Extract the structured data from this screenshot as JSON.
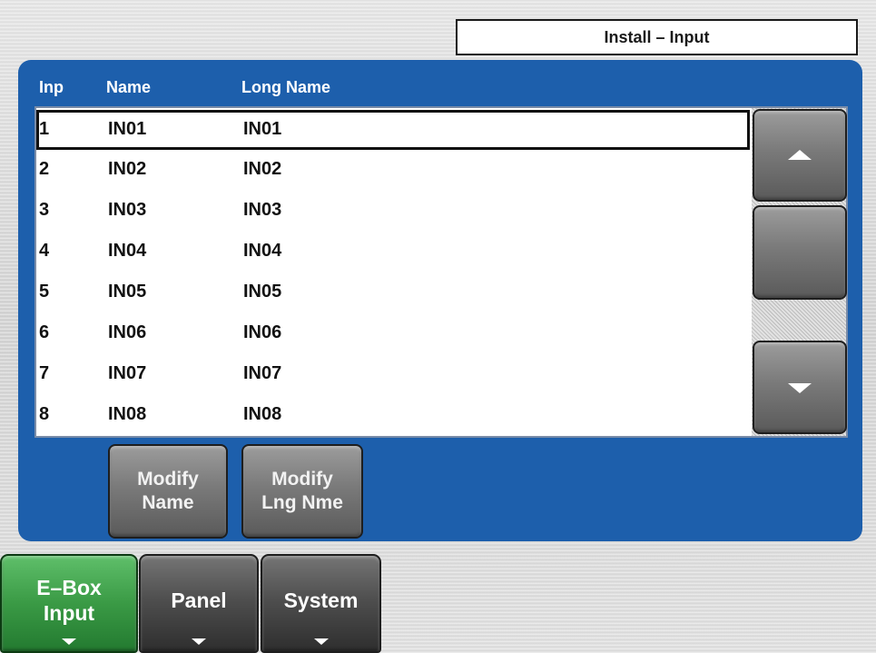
{
  "header": {
    "title": "Install – Input"
  },
  "table": {
    "columns": [
      "Inp",
      "Name",
      "Long Name"
    ],
    "rows": [
      {
        "inp": "1",
        "name": "IN01",
        "long_name": "IN01"
      },
      {
        "inp": "2",
        "name": "IN02",
        "long_name": "IN02"
      },
      {
        "inp": "3",
        "name": "IN03",
        "long_name": "IN03"
      },
      {
        "inp": "4",
        "name": "IN04",
        "long_name": "IN04"
      },
      {
        "inp": "5",
        "name": "IN05",
        "long_name": "IN05"
      },
      {
        "inp": "6",
        "name": "IN06",
        "long_name": "IN06"
      },
      {
        "inp": "7",
        "name": "IN07",
        "long_name": "IN07"
      },
      {
        "inp": "8",
        "name": "IN08",
        "long_name": "IN08"
      }
    ],
    "selected_index": 0
  },
  "scrollbar": {
    "up_icon": "arrow-up-icon",
    "down_icon": "arrow-down-icon"
  },
  "actions": {
    "modify_name": "Modify\nName",
    "modify_long_name": "Modify\nLng Nme"
  },
  "tabs": [
    {
      "label": "E–Box\nInput",
      "active": true
    },
    {
      "label": "Panel",
      "active": false
    },
    {
      "label": "System",
      "active": false
    }
  ],
  "colors": {
    "panel_blue": "#1d5fac",
    "active_tab_green": "#3a9a45",
    "button_gray": "#7a7a7a"
  }
}
